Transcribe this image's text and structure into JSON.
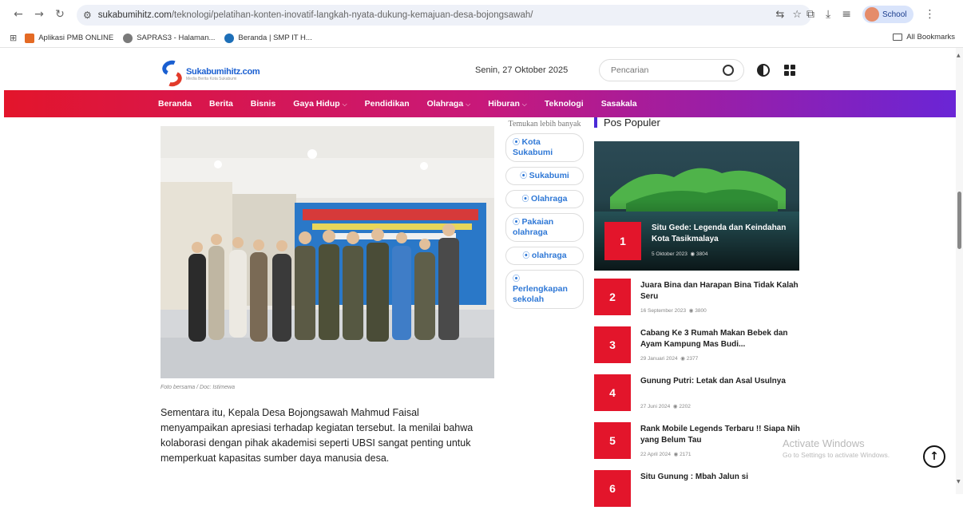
{
  "browser": {
    "url_host": "sukabumihitz.com",
    "url_path": "/teknologi/pelatihan-konten-inovatif-langkah-nyata-dukung-kemajuan-desa-bojongsawah/",
    "profile_label": "School"
  },
  "bookmarks": {
    "items": [
      "Aplikasi PMB ONLINE",
      "SAPRAS3 - Halaman...",
      "Beranda | SMP IT H..."
    ],
    "all_label": "All Bookmarks"
  },
  "header": {
    "brand": "Sukabumihitz.com",
    "tagline": "Media Berita Kota Sukabumi",
    "date": "Senin, 27 Oktober 2025",
    "search_placeholder": "Pencarian"
  },
  "nav": {
    "items": [
      {
        "label": "Beranda",
        "caret": ""
      },
      {
        "label": "Berita",
        "caret": ""
      },
      {
        "label": "Bisnis",
        "caret": ""
      },
      {
        "label": "Gaya Hidup",
        "caret": "⌵"
      },
      {
        "label": "Pendidikan",
        "caret": ""
      },
      {
        "label": "Olahraga",
        "caret": "⌵"
      },
      {
        "label": "Hiburan",
        "caret": "⌵"
      },
      {
        "label": "Teknologi",
        "caret": ""
      },
      {
        "label": "Sasakala",
        "caret": ""
      }
    ]
  },
  "article": {
    "caption": "Foto bersama / Doc: Istimewa",
    "paragraph": "Sementara itu, Kepala Desa Bojongsawah Mahmud Faisal menyampaikan apresiasi terhadap kegiatan tersebut. Ia menilai bahwa kolaborasi dengan pihak akademisi seperti UBSI sangat penting untuk memperkuat kapasitas sumber daya manusia desa."
  },
  "tags": {
    "heading": "Temukan lebih banyak",
    "items": [
      "Kota Sukabumi",
      "Sukabumi",
      "Olahraga",
      "Pakaian olahraga",
      "olahraga",
      "Perlengkapan sekolah"
    ]
  },
  "popular": {
    "heading": "Pos Populer",
    "feature": {
      "rank": "1",
      "title": "Situ Gede: Legenda dan Keindahan Kota Tasikmalaya",
      "date": "5 Oktober 2023",
      "views": "3804"
    },
    "items": [
      {
        "rank": "2",
        "title": "Juara Bina dan Harapan Bina Tidak Kalah Seru",
        "date": "16 September 2023",
        "views": "3800"
      },
      {
        "rank": "3",
        "title": "Cabang Ke 3 Rumah Makan Bebek dan Ayam Kampung Mas Budi...",
        "date": "29 Januari 2024",
        "views": "2377"
      },
      {
        "rank": "4",
        "title": "Gunung Putri: Letak dan Asal Usulnya",
        "date": "27 Juni 2024",
        "views": "2202"
      },
      {
        "rank": "5",
        "title": "Rank Mobile Legends Terbaru !! Siapa Nih yang Belum Tau",
        "date": "22 April 2024",
        "views": "2171"
      },
      {
        "rank": "6",
        "title": "Situ Gunung : Mbah Jalun si",
        "date": "",
        "views": ""
      }
    ]
  },
  "watermark": {
    "line1": "Activate Windows",
    "line2": "Go to Settings to activate Windows."
  },
  "colors": {
    "nav_start": "#e3152b",
    "nav_end": "#6a25d6",
    "rank_bg": "#e3152b",
    "tag_text": "#2f78d6"
  }
}
